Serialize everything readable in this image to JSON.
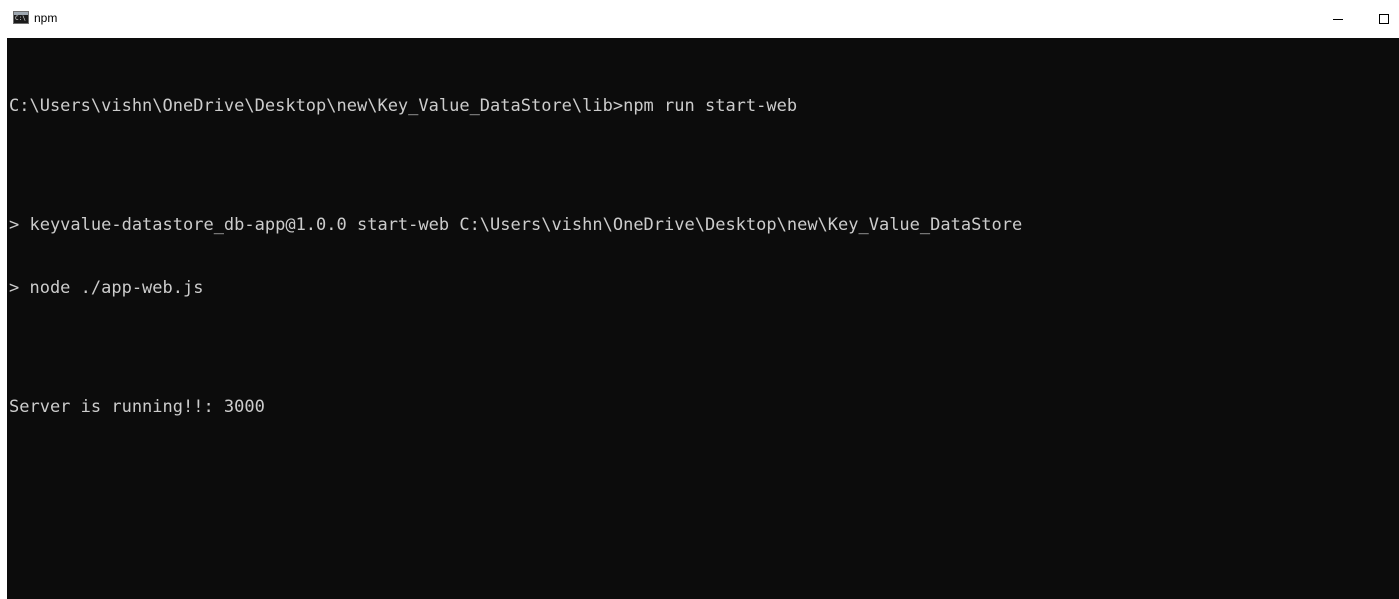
{
  "window": {
    "title": "npm",
    "icon": "cmd-console-icon",
    "icon_glyph": "C:\\",
    "controls": [
      "minimize-icon",
      "maximize-icon"
    ]
  },
  "colors": {
    "console_background": "#0c0c0c",
    "console_text": "#cccccc",
    "titlebar_background": "#ffffff"
  },
  "console": {
    "lines": [
      "C:\\Users\\vishn\\OneDrive\\Desktop\\new\\Key_Value_DataStore\\lib>npm run start-web",
      "",
      "> keyvalue-datastore_db-app@1.0.0 start-web C:\\Users\\vishn\\OneDrive\\Desktop\\new\\Key_Value_DataStore",
      "> node ./app-web.js",
      "",
      "Server is running!!: 3000"
    ]
  }
}
